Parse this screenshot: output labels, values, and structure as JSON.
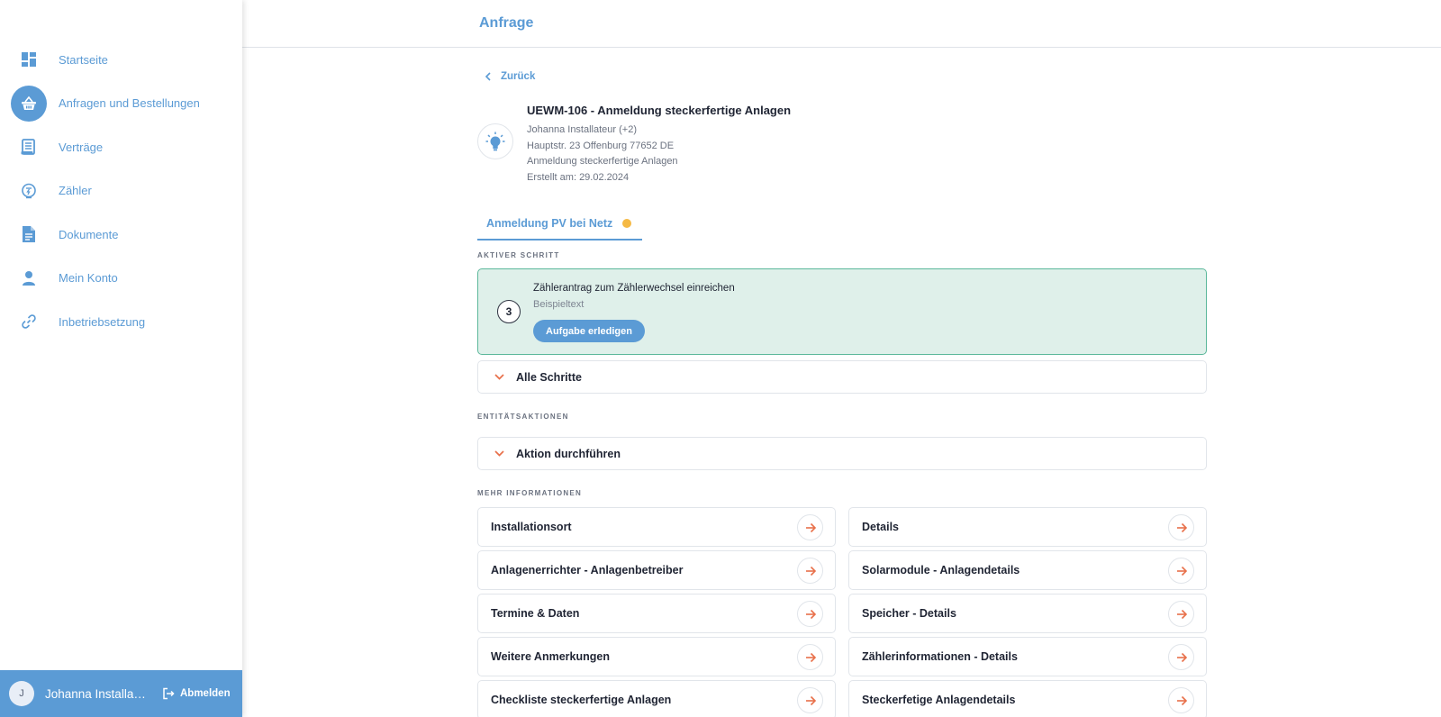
{
  "colors": {
    "accent": "#5b9bd5",
    "success_bg": "#dff0ea",
    "success_border": "#5cb89b",
    "arrow": "#e8704a",
    "status_dot": "#f5b944"
  },
  "sidebar": {
    "items": [
      {
        "label": "Startseite",
        "icon": "dashboard-icon"
      },
      {
        "label": "Anfragen und Bestellungen",
        "icon": "basket-icon",
        "active": true
      },
      {
        "label": "Verträge",
        "icon": "contract-icon"
      },
      {
        "label": "Zähler",
        "icon": "meter-icon"
      },
      {
        "label": "Dokumente",
        "icon": "document-icon"
      },
      {
        "label": "Mein Konto",
        "icon": "user-icon"
      },
      {
        "label": "Inbetriebsetzung",
        "icon": "link-icon"
      }
    ],
    "user": {
      "initial": "J",
      "name": "Johanna Installateur",
      "logout_label": "Abmelden"
    }
  },
  "header": {
    "title": "Anfrage"
  },
  "main": {
    "back_label": "Zurück",
    "request": {
      "title": "UEWM-106 - Anmeldung steckerfertige Anlagen",
      "lines": [
        "Johanna Installateur (+2)",
        "Hauptstr. 23 Offenburg 77652 DE",
        "Anmeldung steckerfertige Anlagen",
        "Erstellt am: 29.02.2024"
      ]
    },
    "tab": {
      "label": "Anmeldung PV bei Netz"
    },
    "active_step_label": "AKTIVER SCHRITT",
    "active_step": {
      "number": "3",
      "title": "Zählerantrag zum Zählerwechsel einreichen",
      "subtitle": "Beispieltext",
      "button_label": "Aufgabe erledigen"
    },
    "all_steps_label": "Alle Schritte",
    "entity_actions_label": "ENTITÄTSAKTIONEN",
    "action_label": "Aktion durchführen",
    "more_info_label": "MEHR INFORMATIONEN",
    "info_left": [
      "Installationsort",
      "Anlagenerrichter - Anlagenbetreiber",
      "Termine & Daten",
      "Weitere Anmerkungen",
      "Checkliste steckerfertige Anlagen"
    ],
    "info_right": [
      "Details",
      "Solarmodule - Anlagendetails",
      "Speicher - Details",
      "Zählerinformationen - Details",
      "Steckerfetige Anlagendetails"
    ]
  }
}
